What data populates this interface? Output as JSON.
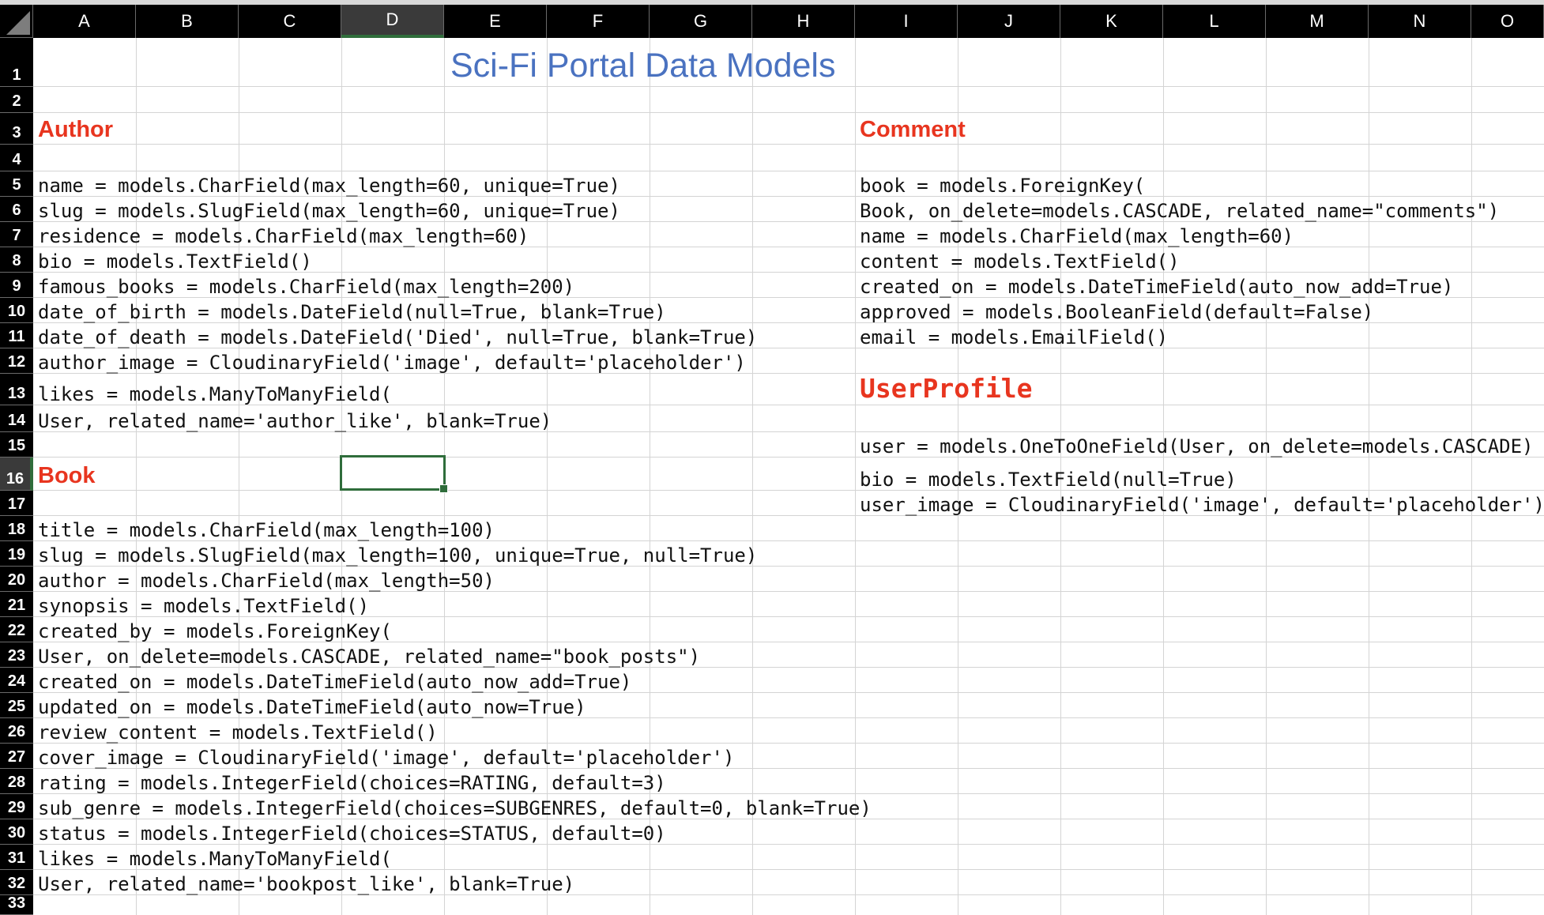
{
  "columns": [
    "A",
    "B",
    "C",
    "D",
    "E",
    "F",
    "G",
    "H",
    "I",
    "J",
    "K",
    "L",
    "M",
    "N",
    "O"
  ],
  "rows": [
    "1",
    "2",
    "3",
    "4",
    "5",
    "6",
    "7",
    "8",
    "9",
    "10",
    "11",
    "12",
    "13",
    "14",
    "15",
    "16",
    "17",
    "18",
    "19",
    "20",
    "21",
    "22",
    "23",
    "24",
    "25",
    "26",
    "27",
    "28",
    "29",
    "30",
    "31",
    "32",
    "33"
  ],
  "selected_cell": {
    "column": "D",
    "row": "16"
  },
  "title": "Sci-Fi Portal Data Models",
  "author": {
    "heading": "Author",
    "lines": [
      "name = models.CharField(max_length=60, unique=True)",
      "slug = models.SlugField(max_length=60, unique=True)",
      "residence = models.CharField(max_length=60)",
      "bio = models.TextField()",
      "famous_books = models.CharField(max_length=200)",
      "date_of_birth = models.DateField(null=True, blank=True)",
      "date_of_death = models.DateField('Died', null=True, blank=True)",
      "author_image = CloudinaryField('image', default='placeholder')",
      "likes = models.ManyToManyField(",
      "User, related_name='author_like', blank=True)"
    ]
  },
  "book": {
    "heading": "Book",
    "lines": [
      "title = models.CharField(max_length=100)",
      "slug = models.SlugField(max_length=100, unique=True, null=True)",
      "author = models.CharField(max_length=50)",
      "synopsis = models.TextField()",
      "created_by = models.ForeignKey(",
      "User, on_delete=models.CASCADE, related_name=\"book_posts\")",
      "created_on = models.DateTimeField(auto_now_add=True)",
      "updated_on = models.DateTimeField(auto_now=True)",
      "review_content = models.TextField()",
      "cover_image = CloudinaryField('image', default='placeholder')",
      "rating = models.IntegerField(choices=RATING, default=3)",
      "sub_genre = models.IntegerField(choices=SUBGENRES, default=0, blank=True)",
      "status = models.IntegerField(choices=STATUS, default=0)",
      "likes = models.ManyToManyField(",
      "User, related_name='bookpost_like', blank=True)"
    ]
  },
  "comment": {
    "heading": "Comment",
    "lines": [
      "book = models.ForeignKey(",
      "Book, on_delete=models.CASCADE, related_name=\"comments\")",
      "name = models.CharField(max_length=60)",
      "content = models.TextField()",
      "created_on = models.DateTimeField(auto_now_add=True)",
      "approved = models.BooleanField(default=False)",
      "email = models.EmailField()"
    ]
  },
  "userprofile": {
    "heading": "UserProfile",
    "lines": [
      "user = models.OneToOneField(User, on_delete=models.CASCADE)",
      "bio = models.TextField(null=True)",
      "user_image = CloudinaryField('image', default='placeholder')"
    ]
  },
  "colors": {
    "title": "#4a72c0",
    "heading": "#e8351f",
    "selection": "#2f6d3b",
    "header_bg": "#000000"
  }
}
